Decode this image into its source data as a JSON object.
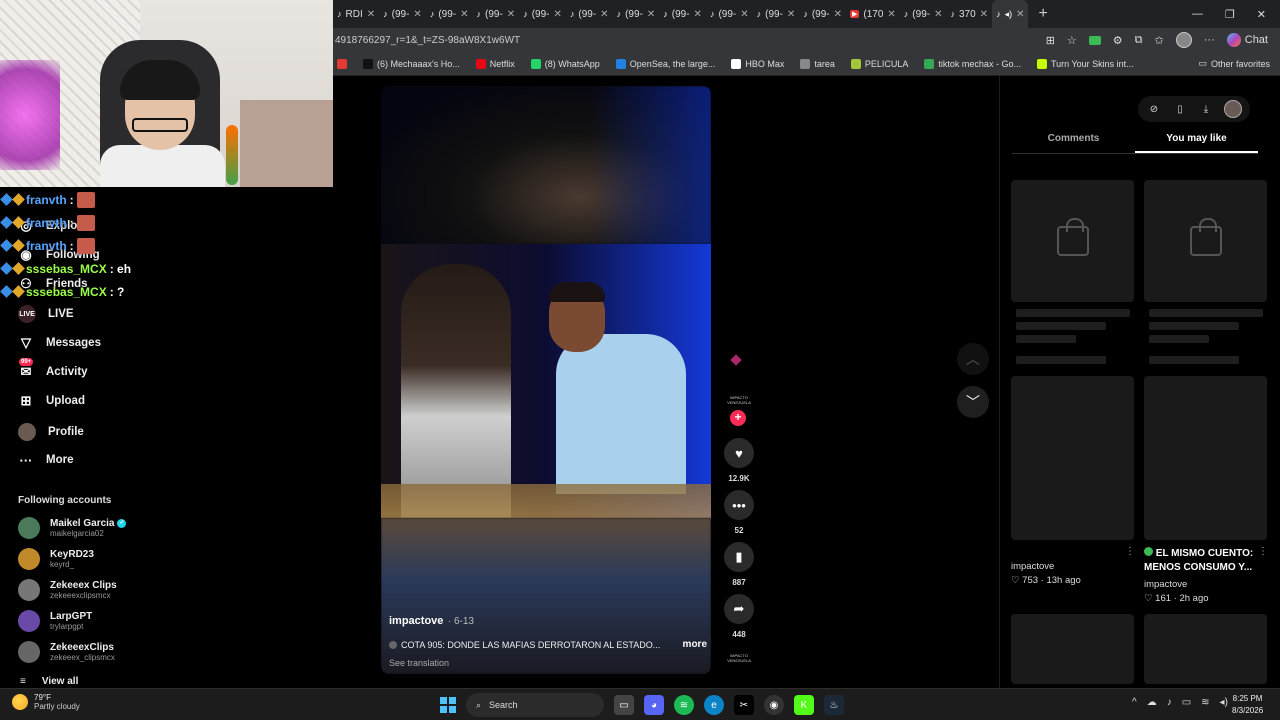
{
  "browser": {
    "tabs": [
      {
        "icon": "tiktok",
        "label": "RDI"
      },
      {
        "icon": "tiktok",
        "label": "(99-"
      },
      {
        "icon": "tiktok",
        "label": "(99-"
      },
      {
        "icon": "tiktok",
        "label": "(99-"
      },
      {
        "icon": "tiktok",
        "label": "(99-"
      },
      {
        "icon": "tiktok",
        "label": "(99-"
      },
      {
        "icon": "tiktok",
        "label": "(99-"
      },
      {
        "icon": "tiktok",
        "label": "(99-"
      },
      {
        "icon": "tiktok",
        "label": "(99-"
      },
      {
        "icon": "tiktok",
        "label": "(99-"
      },
      {
        "icon": "tiktok",
        "label": "(99-"
      },
      {
        "icon": "youtube",
        "label": "(170"
      },
      {
        "icon": "tiktok",
        "label": "(99-"
      },
      {
        "icon": "tiktok",
        "label": "370"
      }
    ],
    "url": "4918766297_r=1&_t=ZS-98aW8X1w6WT",
    "chat_label": "Chat",
    "bookmarks": [
      {
        "label": "(6) Mechaaax's Ho...",
        "color": "#111111"
      },
      {
        "label": "Netflix",
        "color": "#e50914"
      },
      {
        "label": "(8) WhatsApp",
        "color": "#25d366"
      },
      {
        "label": "OpenSea, the large...",
        "color": "#2081e2"
      },
      {
        "label": "HBO Max",
        "color": "#ffffff"
      },
      {
        "label": "tarea",
        "color": "#888888"
      },
      {
        "label": "PELICULA",
        "color": "#a4c639"
      },
      {
        "label": "",
        "color": "#e53935"
      },
      {
        "label": "tiktok mechax - Go...",
        "color": "#34a853"
      },
      {
        "label": "Turn Your Skins int...",
        "color": "#c6ff00"
      }
    ],
    "other_favorites": "Other favorites"
  },
  "chat_overlay": [
    {
      "user": "franvth",
      "msg": ":",
      "style": "blue",
      "emote": true
    },
    {
      "user": "franvth",
      "msg": ":",
      "style": "blue",
      "emote": true
    },
    {
      "user": "franvth",
      "msg": ":",
      "style": "blue",
      "emote": true
    },
    {
      "user": "sssebas_MCX",
      "msg": ": eh",
      "style": "green",
      "emote": false
    },
    {
      "user": "sssebas_MCX",
      "msg": ": ?",
      "style": "green",
      "emote": false
    }
  ],
  "sidebar": {
    "items": [
      {
        "label": "Explore",
        "icon": "compass-icon",
        "glyph": "◎"
      },
      {
        "label": "Following",
        "icon": "following-icon",
        "glyph": "◉"
      },
      {
        "label": "Friends",
        "icon": "friends-icon",
        "glyph": "⚇"
      },
      {
        "label": "LIVE",
        "icon": "live-icon",
        "glyph": "LIVE"
      },
      {
        "label": "Messages",
        "icon": "paper-plane-icon",
        "glyph": "▽"
      },
      {
        "label": "Activity",
        "icon": "inbox-icon",
        "glyph": "✉"
      },
      {
        "label": "Upload",
        "icon": "upload-icon",
        "glyph": "⊞"
      },
      {
        "label": "Profile",
        "icon": "profile-icon",
        "glyph": ""
      },
      {
        "label": "More",
        "icon": "more-icon",
        "glyph": "···"
      }
    ],
    "activity_badge": "99+",
    "following_heading": "Following accounts",
    "accounts": [
      {
        "name": "Maikel Garcia",
        "handle": "maikelgarcia02",
        "verified": true,
        "color": "#4a7a5a"
      },
      {
        "name": "KeyRD23",
        "handle": "keyrd_",
        "verified": false,
        "color": "#c08a2a"
      },
      {
        "name": "Zekeeex Clips",
        "handle": "zekeeexclipsmcx",
        "verified": false,
        "color": "#777777"
      },
      {
        "name": "LarpGPT",
        "handle": "trylarpgpt",
        "verified": false,
        "color": "#6a4aa8"
      },
      {
        "name": "ZekeeexClips",
        "handle": "zekeeex_clipsmcx",
        "verified": false,
        "color": "#666666"
      }
    ],
    "view_all": "View all"
  },
  "video": {
    "author": "impactove",
    "date": "· 6-13",
    "description": "COTA 905: DONDE LAS MAFIAS DERROTARON AL ESTADO...",
    "more": "more",
    "translate": "See translation"
  },
  "actions": {
    "avatar_text": "IMPACTO VENEZUELA",
    "likes": "12.9K",
    "comments": "52",
    "saves": "887",
    "shares": "448",
    "music_text": "IMPACTO VENEZUELA"
  },
  "right_panel": {
    "tabs": [
      "Comments",
      "You may like"
    ],
    "active_tab": 1,
    "items": [
      {
        "author": "impactove",
        "meta": "♡ 753 · 13h ago"
      },
      {
        "title": "EL MISMO CUENTO: MENOS CONSUMO Y...",
        "author": "impactove",
        "meta": "♡ 161 · 2h ago"
      }
    ]
  },
  "taskbar": {
    "temp": "79°F",
    "weather": "Partly cloudy",
    "search": "Search",
    "time": "8:25 PM",
    "date": "8/3/2026"
  }
}
